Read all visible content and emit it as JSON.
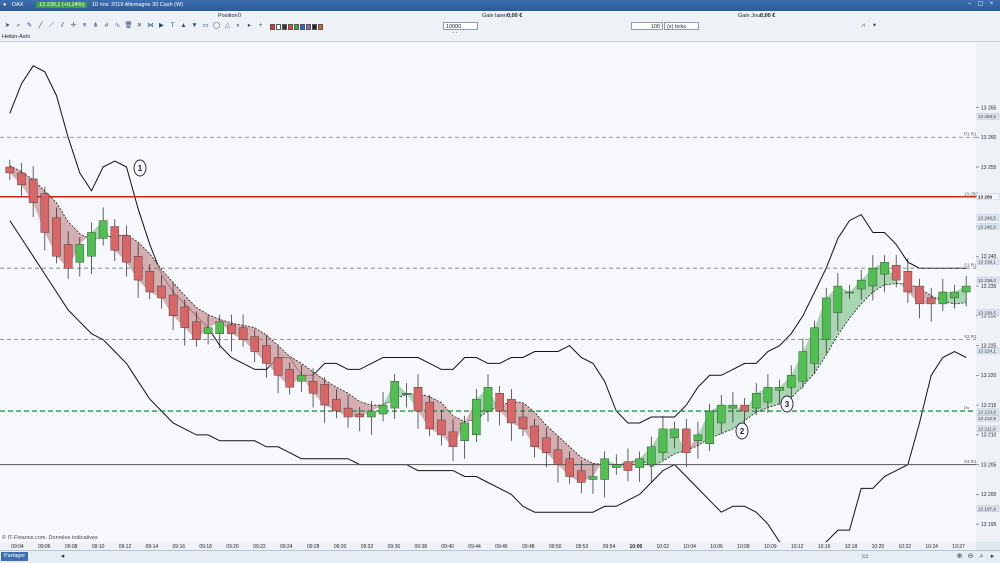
{
  "titlebar": {
    "instrument": "DAX",
    "quote": "13 239,1 (+0,24%)",
    "subtitle": "10 nov. 2019 Allemagne 30 Cash (W)"
  },
  "toolbar": {
    "position_label": "Position",
    "position_value": "0",
    "latent_label": "Gain latent :",
    "latent_value": "0,00 €",
    "daily_label": "Gain Jour :",
    "daily_value": "0,00 €",
    "units_value": "10000 unités",
    "ticks_value": "100",
    "ticks_unit": "(x) ticks"
  },
  "indicator_label": "Heikin-Ashi",
  "watermark": "© IT-Finance.com. Données indicatives",
  "status": {
    "share_label": "Partager"
  },
  "colors": {
    "bull": "#4fbf4f",
    "bear": "#d96666",
    "cloud_bull": "#8fc99a",
    "cloud_bear": "#c9969a"
  },
  "icons": [
    "cursor-icon",
    "zoom-icon",
    "pencil-icon",
    "trendline-icon",
    "fibonacci-icon",
    "text-icon",
    "arrow-up-icon",
    "arrow-down-icon",
    "rectangle-icon",
    "ellipse-icon",
    "triangle-icon",
    "palette-icon"
  ],
  "chart_data": {
    "type": "candlestick",
    "title": "",
    "xlabel": "",
    "ylabel": "",
    "ylim": [
      13192,
      13276
    ],
    "y_ticks": [
      13195,
      13200,
      13205,
      13210,
      13215,
      13220,
      13225,
      13230,
      13235,
      13240,
      13245,
      13250,
      13255,
      13260,
      13265
    ],
    "x_ticks": [
      "09:04",
      "09:06",
      "09:08",
      "09:10",
      "09:12",
      "09:14",
      "09:16",
      "09:18",
      "09:20",
      "09:22",
      "09:24",
      "09:28",
      "09:30",
      "09:32",
      "09:36",
      "09:38",
      "09:40",
      "09:44",
      "09:46",
      "09:48",
      "09:50",
      "09:52",
      "09:54",
      "10:00",
      "10:02",
      "10:04",
      "10:06",
      "10:08",
      "10:09",
      "10:12",
      "10:16",
      "10:18",
      "10:20",
      "10:22",
      "10:24",
      "10:27"
    ],
    "price_tags": [
      "13 263,5",
      "13 250",
      "13 246,5",
      "13 245,0",
      "13 239,1",
      "13 236,0",
      "13 230,5",
      "13 224,1",
      "13 213,9",
      "13 212,8",
      "13 211,0",
      "13 197,6"
    ],
    "horizontal_levels": [
      {
        "label": "P1 R1",
        "value": 13260,
        "style": "dashed-gray"
      },
      {
        "label": "13 250",
        "value": 13250,
        "style": "solid-red"
      },
      {
        "label": "S1 R1",
        "value": 13238,
        "style": "dashed-gray"
      },
      {
        "label": "S2 R1",
        "value": 13226,
        "style": "dashed-gray"
      },
      {
        "label": "Pv",
        "value": 13214,
        "style": "dashed-green"
      },
      {
        "label": "S3 R1",
        "value": 13205,
        "style": "solid-gray"
      }
    ],
    "annotations": [
      "1",
      "2",
      "3"
    ],
    "close": [
      13254,
      13252,
      13249,
      13244,
      13240,
      13238,
      13242,
      13244,
      13246,
      13241,
      13239,
      13236,
      13234,
      13233,
      13230,
      13228,
      13226,
      13228,
      13229,
      13227,
      13226,
      13224,
      13222,
      13220,
      13218,
      13220,
      13217,
      13215,
      13214,
      13213,
      13213,
      13214,
      13215,
      13219,
      13217,
      13214,
      13211,
      13210,
      13208,
      13212,
      13216,
      13218,
      13214,
      13212,
      13211,
      13208,
      13207,
      13205,
      13203,
      13202,
      13203,
      13206,
      13205,
      13204,
      13206,
      13208,
      13211,
      13211,
      13207,
      13210,
      13214,
      13215,
      13215,
      13214,
      13217,
      13218,
      13218,
      13220,
      13224,
      13228,
      13233,
      13235,
      13234,
      13236,
      13238,
      13239,
      13236,
      13234,
      13232,
      13232,
      13234,
      13234,
      13235
    ],
    "lower_band": [
      13246,
      13243,
      13240,
      13237,
      13234,
      13231,
      13229,
      13227,
      13226,
      13224,
      13222,
      13219,
      13216,
      13214,
      13212,
      13211,
      13210,
      13210,
      13209,
      13209,
      13209,
      13209,
      13208,
      13208,
      13207,
      13206,
      13206,
      13206,
      13206,
      13206,
      13205,
      13205,
      13205,
      13205,
      13205,
      13204,
      13204,
      13204,
      13204,
      13203,
      13203,
      13202,
      13201,
      13200,
      13198,
      13197,
      13197,
      13197,
      13197,
      13197,
      13197,
      13198,
      13198,
      13199,
      13200,
      13202,
      13204,
      13205,
      13203,
      13201,
      13199,
      13197,
      13198,
      13198,
      13197,
      13195,
      13192,
      13191,
      13190,
      13191,
      13192,
      13194,
      13194,
      13201,
      13201,
      13203,
      13204,
      13205,
      13212,
      13220,
      13223,
      13224,
      13223
    ],
    "upper_band": [
      13264,
      13269,
      13272,
      13271,
      13267,
      13260,
      13254,
      13251,
      13255,
      13256,
      13255,
      13248,
      13242,
      13237,
      13234,
      13232,
      13230,
      13228,
      13225,
      13223,
      13222,
      13221,
      13221,
      13223,
      13223,
      13220,
      13220,
      13222,
      13222,
      13221,
      13221,
      13222,
      13223,
      13223,
      13223,
      13223,
      13222,
      13221,
      13221,
      13223,
      13223,
      13222,
      13222,
      13223,
      13223,
      13224,
      13224,
      13224,
      13225,
      13223,
      13222,
      13219,
      13214,
      13212,
      13212,
      13213,
      13213,
      13213,
      13215,
      13218,
      13220,
      13220,
      13221,
      13222,
      13222,
      13224,
      13225,
      13227,
      13230,
      13234,
      13238,
      13243,
      13246,
      13247,
      13244,
      13244,
      13242,
      13239,
      13238,
      13238,
      13238,
      13238,
      13238
    ]
  }
}
